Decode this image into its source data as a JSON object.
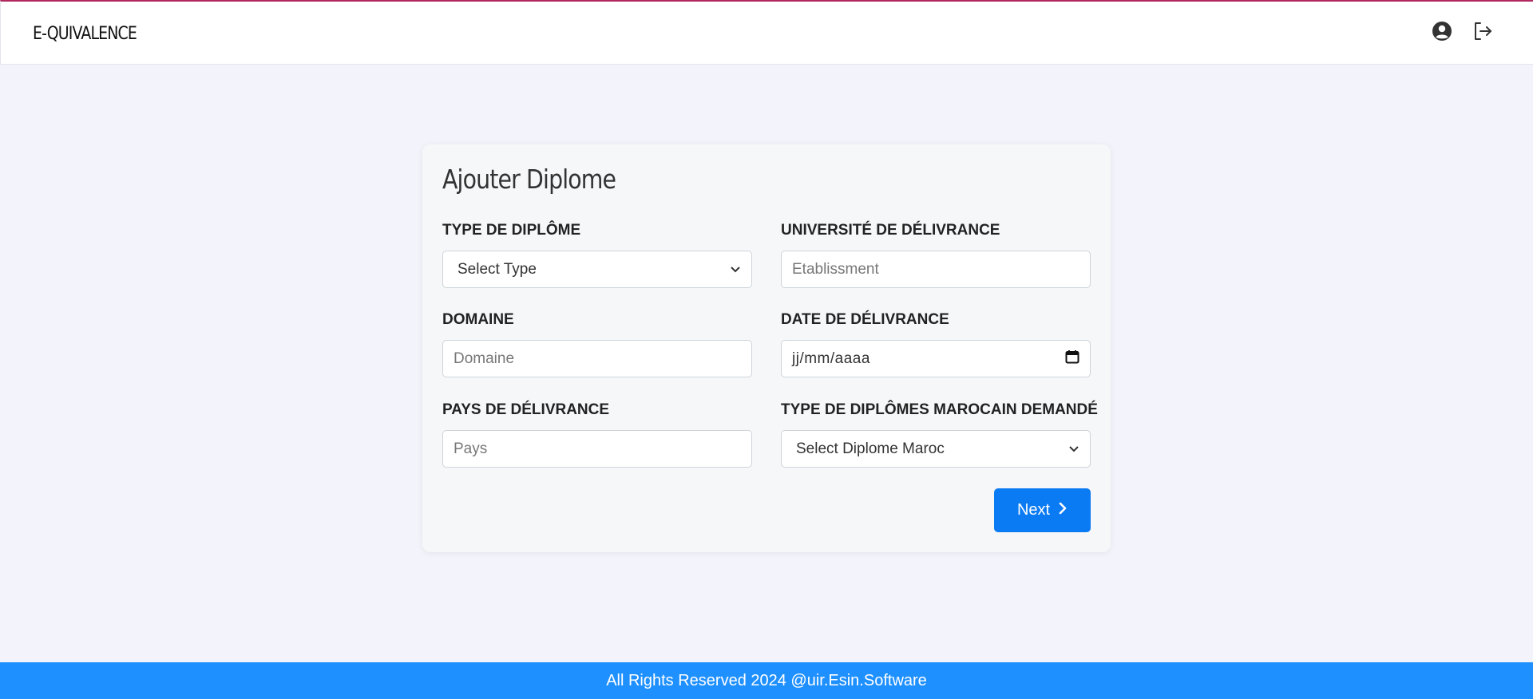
{
  "header": {
    "brand": "E-QUIVALENCE",
    "icons": [
      "user-circle-icon",
      "logout-icon"
    ]
  },
  "form": {
    "title": "Ajouter Diplome",
    "type_diplome": {
      "label": "TYPE DE DIPLÔME",
      "value": "Select Type"
    },
    "universite": {
      "label": "UNIVERSITÉ DE DÉLIVRANCE",
      "placeholder": "Etablissment"
    },
    "domaine": {
      "label": "DOMAINE",
      "placeholder": "Domaine"
    },
    "date": {
      "label": "DATE DE DÉLIVRANCE",
      "placeholder": "jj/mm/aaaa"
    },
    "pays": {
      "label": "PAYS DE DÉLIVRANCE",
      "placeholder": "Pays"
    },
    "diplome_maroc": {
      "label": "TYPE DE DIPLÔMES MAROCAIN DEMANDÉ",
      "value": "Select Diplome Maroc"
    },
    "next_label": "Next"
  },
  "footer": {
    "text": "All Rights Reserved 2024 @uir.Esin.Software"
  },
  "colors": {
    "background": "#f3f4fb",
    "primary_button": "#0b7bf3",
    "footer": "#1e90ff",
    "top_accent": "#b0285e"
  }
}
